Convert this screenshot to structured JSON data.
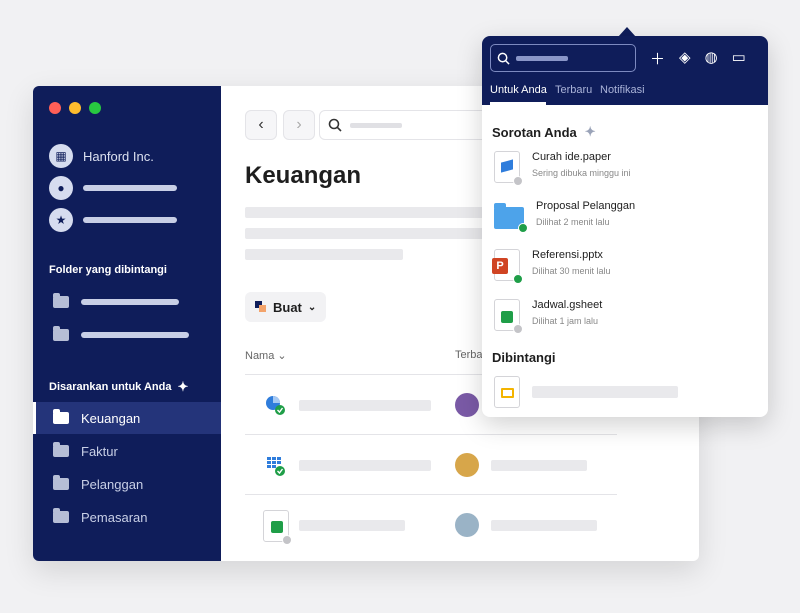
{
  "sidebar": {
    "account_name": "Hanford Inc.",
    "starred_heading": "Folder yang dibintangi",
    "suggested_heading": "Disarankan untuk Anda",
    "folders": [
      {
        "label": "Keuangan",
        "active": true
      },
      {
        "label": "Faktur",
        "active": false
      },
      {
        "label": "Pelanggan",
        "active": false
      },
      {
        "label": "Pemasaran",
        "active": false
      }
    ]
  },
  "main": {
    "title": "Keuangan",
    "create_label": "Buat",
    "col_name": "Nama",
    "col_recent": "Terba"
  },
  "popup": {
    "tabs": [
      "Untuk Anda",
      "Terbaru",
      "Notifikasi"
    ],
    "highlights_heading": "Sorotan Anda",
    "items": [
      {
        "title": "Curah ide.paper",
        "sub": "Sering dibuka minggu ini",
        "icon": "paper-doc-icon"
      },
      {
        "title": "Proposal Pelanggan",
        "sub": "Dilihat 2 menit lalu",
        "icon": "folder-icon"
      },
      {
        "title": "Referensi.pptx",
        "sub": "Dilihat 30 menit lalu",
        "icon": "powerpoint-icon"
      },
      {
        "title": "Jadwal.gsheet",
        "sub": "Dilihat 1 jam lalu",
        "icon": "sheet-icon"
      }
    ],
    "starred_heading": "Dibintangi"
  }
}
